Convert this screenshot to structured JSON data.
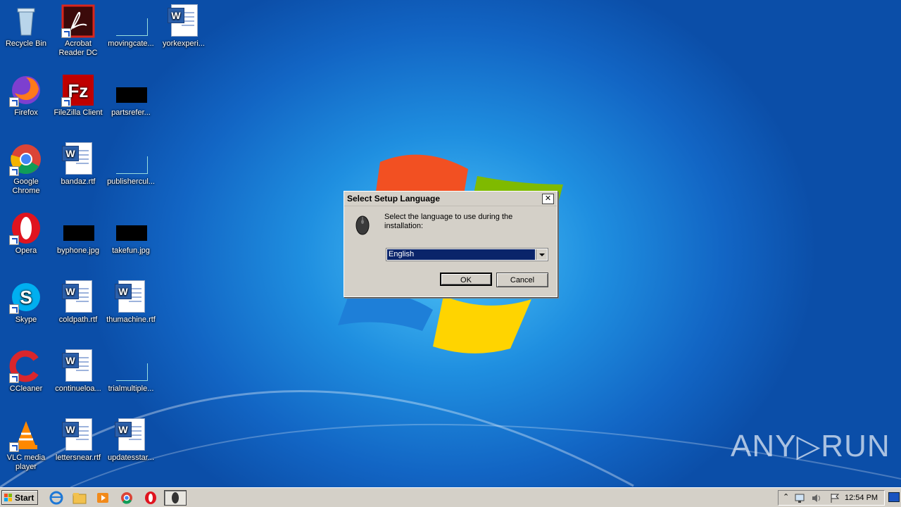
{
  "desktop": {
    "icons": [
      {
        "label": "Recycle Bin"
      },
      {
        "label": "Acrobat\nReader DC"
      },
      {
        "label": "movingcate..."
      },
      {
        "label": "yorkexperi..."
      },
      {
        "label": "Firefox"
      },
      {
        "label": "FileZilla Client"
      },
      {
        "label": "partsrefer..."
      },
      {
        "label": "Google\nChrome"
      },
      {
        "label": "bandaz.rtf"
      },
      {
        "label": "publishercul..."
      },
      {
        "label": "Opera"
      },
      {
        "label": "byphone.jpg"
      },
      {
        "label": "takefun.jpg"
      },
      {
        "label": "Skype"
      },
      {
        "label": "coldpath.rtf"
      },
      {
        "label": "thumachine.rtf"
      },
      {
        "label": "CCleaner"
      },
      {
        "label": "continueloa..."
      },
      {
        "label": "trialmultiple..."
      },
      {
        "label": "VLC media\nplayer"
      },
      {
        "label": "lettersnear.rtf"
      },
      {
        "label": "updatesstar..."
      }
    ]
  },
  "dialog": {
    "title": "Select Setup Language",
    "close_glyph": "✕",
    "message": "Select the language to use during the installation:",
    "selected_language": "English",
    "ok_label": "OK",
    "cancel_label": "Cancel"
  },
  "taskbar": {
    "start_label": "Start",
    "clock": "12:54 PM"
  },
  "watermark": "ANY▷RUN",
  "colors": {
    "selection": "#0a246a",
    "chrome": "#d4d0c8"
  }
}
